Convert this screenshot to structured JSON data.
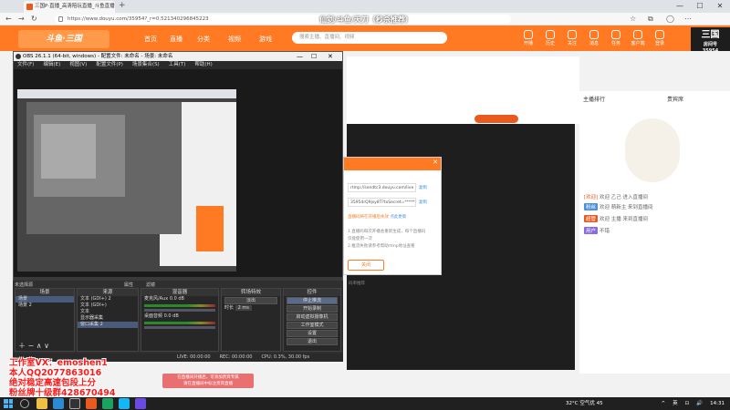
{
  "browser": {
    "tab_title": "三国P·直播_高清陪玩直播_斗鱼直播",
    "new_tab": "+",
    "url": "https://www.douyu.com/35954?_r=0.521340296845223",
    "overlay_title": "飞驰 · 第4赛季之（只要直播）",
    "overlay_sub": "仙剑/斗鱼/天刀（秒杀推荐）"
  },
  "douyu": {
    "logo": "斗鱼·三国",
    "nav": [
      "首页",
      "直播",
      "分类",
      "视频",
      "游戏",
      "鱼吧",
      "活动"
    ],
    "search_placeholder": "搜索主播、直播间、视频",
    "icons": [
      "开播",
      "历史",
      "关注",
      "消息",
      "任务",
      "客户端",
      "登录"
    ],
    "room_id": "35954",
    "room_logo_main": "三国",
    "room_logo_sub": "房间号",
    "rank_label": "主播排行",
    "fans_label": "贵宾席",
    "chat": [
      {
        "user": "[欢迎]",
        "text": "欢迎 乙己 进入直播间"
      },
      {
        "user": "粉丝",
        "text": "欢迎 萌新主 来到直播间"
      },
      {
        "user": "超管",
        "text": "欢迎 主播 来到直播间"
      },
      {
        "user": "用户",
        "text": "不错"
      }
    ]
  },
  "obs": {
    "title": "OBS 26.1.1 (64-bit, windows) - 配置文件: 未命名 - 场景: 未命名",
    "menu": [
      "文件(F)",
      "编辑(E)",
      "视图(V)",
      "配置文件(P)",
      "场景集合(S)",
      "工具(T)",
      "帮助(H)"
    ],
    "no_source": "未选择源",
    "properties": "属性",
    "filters": "滤镜",
    "docks": {
      "scenes_title": "场景",
      "scenes": [
        "场景",
        "场景 2"
      ],
      "sources_title": "来源",
      "sources": [
        "文本 (GDI+) 2",
        "文本 (GDI+)",
        "文本",
        "显示器采集",
        "窗口采集 2"
      ],
      "mixer_title": "混音器",
      "mixer": [
        {
          "name": "麦克风/Aux",
          "db": "0.0 dB"
        },
        {
          "name": "桌面音频",
          "db": "0.0 dB"
        }
      ],
      "transitions_title": "转场特效",
      "transition_type": "淡出",
      "duration_label": "时长",
      "duration_value": "2 ms",
      "controls_title": "控件",
      "controls": [
        "停止推流",
        "开始录制",
        "启动虚拟摄像机",
        "工作室模式",
        "设置",
        "退出"
      ]
    },
    "status": {
      "live": "LIVE: 00:00:00",
      "rec": "REC: 00:00:00",
      "cpu": "CPU: 0.3%, 30.00 fps"
    }
  },
  "dialog": {
    "server": "rtmp://sendtc3.douyu.com/live",
    "key": "35954rQ9jsy8T?txSecret=*******",
    "copy": "复制",
    "warning": "直播码将在开播后失效",
    "warning_link": "点此更新",
    "note1": "1.直播码每次开播会重新生成，每个直播码",
    "note2": "仅能使用一次",
    "note3": "2.推流失败请参考帮助rtmp地址查看",
    "button": "关闭",
    "tip": "码率推荐"
  },
  "promo": [
    "工作室VX：emoshen1",
    "本人QQ2077863016",
    "绝对稳定高速包段上分",
    "粉丝牌十级群428670494"
  ],
  "toast": [
    "在直播间开播后，可添加贵宾专属",
    "请在直播间中标注贵宾直播"
  ],
  "taskbar": {
    "weather": "32°C 空气优 45",
    "time": "14:31",
    "tray": [
      "^",
      "英",
      "⊡",
      "🔊"
    ]
  },
  "colors": {
    "douyu_orange": "#ff7a22",
    "obs_dark": "#2f2f2f",
    "promo_red": "#ff1a1a"
  }
}
